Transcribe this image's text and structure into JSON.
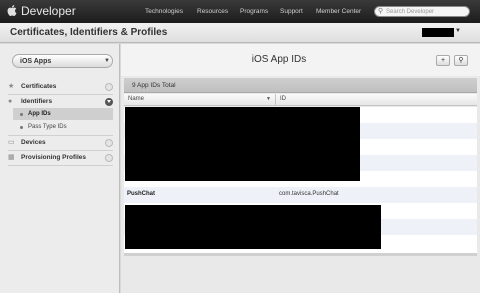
{
  "header": {
    "brand": "Developer",
    "nav": [
      "Technologies",
      "Resources",
      "Programs",
      "Support",
      "Member Center"
    ],
    "search_placeholder": "Search Developer"
  },
  "titlebar": {
    "title": "Certificates, Identifiers & Profiles"
  },
  "sidebar": {
    "platform_select": "iOS Apps",
    "sections": [
      {
        "label": "Certificates"
      },
      {
        "label": "Identifiers",
        "children": [
          {
            "label": "App IDs",
            "active": true
          },
          {
            "label": "Pass Type IDs"
          }
        ]
      },
      {
        "label": "Devices"
      },
      {
        "label": "Provisioning Profiles"
      }
    ]
  },
  "main": {
    "title": "iOS App IDs",
    "add_button": "+",
    "summary": "9 App IDs Total",
    "columns": [
      "Name",
      "ID"
    ],
    "rows": [
      {
        "name": "PushChat",
        "id": "com.tavisca.PushChat"
      }
    ]
  },
  "colors": {
    "topbar": "#1c1c1c",
    "selected_row": "#cfcfcf",
    "alt_row": "#eef2f8"
  }
}
